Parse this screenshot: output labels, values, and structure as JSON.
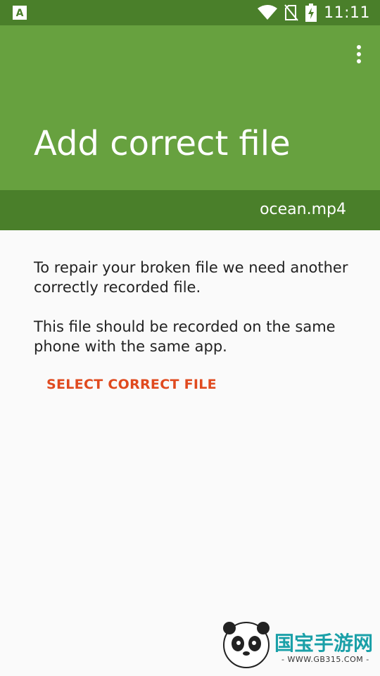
{
  "status_bar": {
    "time": "11:11",
    "icons": [
      "app-a-icon",
      "wifi-icon",
      "no-sim-icon",
      "battery-charging-icon"
    ]
  },
  "app_bar": {
    "title": "Add correct file",
    "menu_icon": "more-vert-icon"
  },
  "file_bar": {
    "file_name": "ocean.mp4"
  },
  "content": {
    "paragraph_1": "To repair your broken file we need another correctly recorded file.",
    "paragraph_2": "This file should be recorded on the same phone with the same app.",
    "select_label": "SELECT CORRECT FILE"
  },
  "watermark": {
    "brand": "国宝手游网",
    "url": "- WWW.GB315.COM -"
  },
  "colors": {
    "status_bar": "#4a7f2a",
    "app_bar": "#67a13f",
    "file_bar": "#4a7f2a",
    "accent": "#e04a1f",
    "background": "#fafafa"
  }
}
